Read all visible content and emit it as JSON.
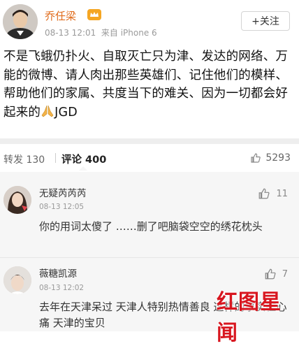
{
  "post": {
    "author": "乔任梁",
    "time": "08-13 12:01",
    "source": "来自 iPhone 6",
    "follow_label": "+关注",
    "text_before_emoji": "不是飞蛾仍扑火、自取灭亡只为津、发达的网络、万能的微博、请人肉出那些英雄们、记住他们的模样、帮助他们的家属、共度当下的难关、因为一切都会好起来的",
    "text_after_emoji": "JGD",
    "emoji": "pray-hands-icon"
  },
  "tabs": {
    "repost": "转发 130",
    "comment": "评论 400",
    "like": "5293"
  },
  "comments": [
    {
      "name": "无疑芮芮芮",
      "time": "08-13 12:05",
      "likes": "11",
      "text": "你的用词太傻了 ……删了吧脑袋空空的绣花枕头"
    },
    {
      "name": "薇糖凯源",
      "time": "08-13 12:02",
      "likes": "7",
      "text": "去年在天津呆过 天津人特别热情善良 这样的事实在心痛 天津的宝贝"
    }
  ],
  "watermark": "红图星闻",
  "colors": {
    "author": "#e06b1b",
    "vip_badge": "#f5a623",
    "watermark": "#d8161f",
    "comment_bg": "#f6f6f6"
  }
}
